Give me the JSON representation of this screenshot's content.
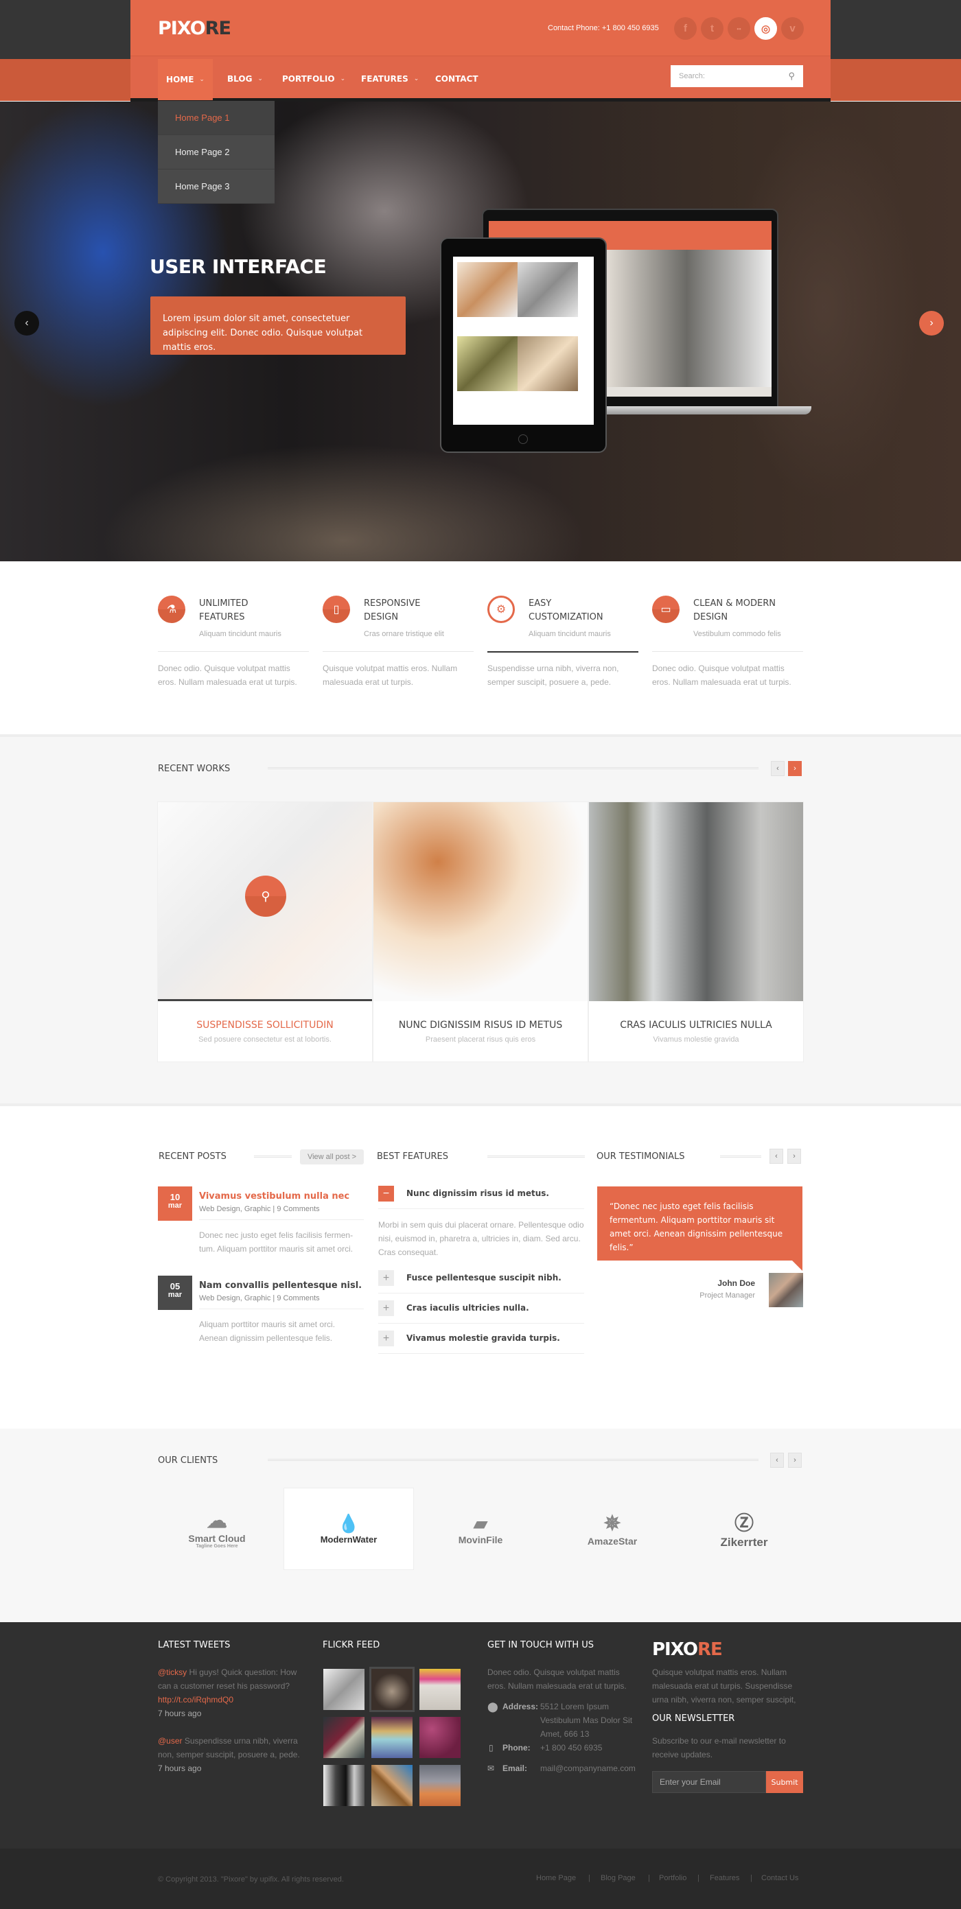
{
  "header": {
    "logo_part1": "PIXO",
    "logo_part2": "RE",
    "contact_phone": "Contact Phone: +1 800 450 6935",
    "social": [
      {
        "icon": "facebook-icon",
        "glyph": "f"
      },
      {
        "icon": "twitter-icon",
        "glyph": "t"
      },
      {
        "icon": "flickr-icon",
        "glyph": "••"
      },
      {
        "icon": "dribbble-icon",
        "glyph": "◎"
      },
      {
        "icon": "vimeo-icon",
        "glyph": "v"
      }
    ],
    "nav": [
      {
        "label": "HOME",
        "has_dropdown": true
      },
      {
        "label": "BLOG",
        "has_dropdown": true
      },
      {
        "label": "PORTFOLIO",
        "has_dropdown": true
      },
      {
        "label": "FEATURES",
        "has_dropdown": true
      },
      {
        "label": "CONTACT",
        "has_dropdown": false
      }
    ],
    "chevron": "⌄",
    "search_placeholder": "Search:",
    "search_icon": "⚲",
    "dropdown": [
      "Home Page 1",
      "Home Page 2",
      "Home Page 3"
    ]
  },
  "hero": {
    "title": "USER INTERFACE",
    "caption": "Lorem ipsum dolor sit amet, consectetuer adipiscing elit. Donec odio. Quisque volutpat mattis eros.",
    "prev_glyph": "‹",
    "next_glyph": "›"
  },
  "features": [
    {
      "icon": "flask-icon",
      "glyph": "⚗",
      "title": "UNLIMITED FEATURES",
      "subtitle": "Aliquam tincidunt mauris",
      "desc": "Donec odio. Quisque volutpat mattis eros. Nullam malesuada erat ut turpis."
    },
    {
      "icon": "mobile-icon",
      "glyph": "▯",
      "title": "RESPONSIVE DESIGN",
      "subtitle": "Cras ornare tristique elit",
      "desc": "Quisque volutpat mattis eros. Nullam malesuada erat ut turpis."
    },
    {
      "icon": "gear-icon",
      "glyph": "⚙",
      "title": "EASY CUSTOMIZATION",
      "subtitle": "Aliquam tincidunt mauris",
      "desc": "Suspendisse urna nibh, viverra non, semper suscipit, posuere a, pede."
    },
    {
      "icon": "monitor-icon",
      "glyph": "▭",
      "title": "CLEAN & MODERN DESIGN",
      "subtitle": "Vestibulum commodo felis",
      "desc": "Donec odio. Quisque volutpat mattis eros. Nullam malesuada erat ut turpis."
    }
  ],
  "recent_works": {
    "title": "RECENT WORKS",
    "prev": "‹",
    "next": "›",
    "zoom_glyph": "⚲",
    "items": [
      {
        "title": "SUSPENDISSE SOLLICITUDIN",
        "subtitle": "Sed posuere consectetur est at lobortis."
      },
      {
        "title": "NUNC DIGNISSIM RISUS ID METUS",
        "subtitle": "Praesent placerat risus quis eros"
      },
      {
        "title": "CRAS IACULIS ULTRICIES NULLA",
        "subtitle": "Vivamus molestie gravida"
      }
    ]
  },
  "recent_posts": {
    "title": "RECENT POSTS",
    "view_all": "View all post >",
    "posts": [
      {
        "day": "10",
        "month": "mar",
        "title": "Vivamus vestibulum nulla nec",
        "meta": "Web Design, Graphic | 9 Comments",
        "excerpt": "Donec nec justo eget felis facilisis fermen-tum. Aliquam porttitor mauris sit amet orci."
      },
      {
        "day": "05",
        "month": "mar",
        "title": "Nam convallis pellentesque nisl.",
        "meta": "Web Design, Graphic | 9 Comments",
        "excerpt": "Aliquam porttitor mauris sit amet orci. Aenean dignissim pellentesque felis."
      }
    ]
  },
  "best_features": {
    "title": "BEST FEATURES",
    "items": [
      {
        "title": "Nunc dignissim risus id metus.",
        "open": true,
        "body": "Morbi in sem quis dui placerat ornare. Pellentesque odio nisi, euismod in, pharetra a, ultricies in, diam. Sed arcu. Cras consequat."
      },
      {
        "title": "Fusce pellentesque suscipit nibh.",
        "open": false
      },
      {
        "title": "Cras iaculis ultricies nulla.",
        "open": false
      },
      {
        "title": "Vivamus molestie gravida turpis.",
        "open": false
      }
    ],
    "minus": "−",
    "plus": "+"
  },
  "testimonials": {
    "title": "OUR TESTIMONIALS",
    "quote": "“Donec nec justo eget felis facilisis fermentum. Aliquam porttitor mauris sit amet orci. Aenean dignissim pellentesque felis.”",
    "name": "John Doe",
    "role": "Project Manager",
    "prev": "‹",
    "next": "›"
  },
  "clients": {
    "title": "OUR CLIENTS",
    "prev": "‹",
    "next": "›",
    "logos": [
      {
        "name": "Smart Cloud",
        "tagline": "Tagline Goes Here",
        "glyph": "☁"
      },
      {
        "name": "ModernWater",
        "tagline": "",
        "glyph": "💧"
      },
      {
        "name": "MovinFile",
        "tagline": "",
        "glyph": "▰"
      },
      {
        "name": "AmazeStar",
        "tagline": "",
        "glyph": "✵"
      },
      {
        "name": "Zikerrter",
        "tagline": "",
        "glyph": "Ⓩ"
      }
    ]
  },
  "footer": {
    "tweets_title": "LATEST TWEETS",
    "tweets": [
      {
        "handle": "@ticksy",
        "text": " Hi guys! Quick question: How can a customer reset his password?",
        "link": "http://t.co/iRqhmdQ0",
        "time": "7 hours ago"
      },
      {
        "handle": "@user",
        "text": " Suspendisse urna nibh, viverra non, semper suscipit, posuere a, pede.",
        "link": "",
        "time": "7 hours ago"
      }
    ],
    "flickr_title": "FLICKR FEED",
    "contact_title": "GET IN TOUCH WITH US",
    "contact_intro": "Donec odio. Quisque volutpat mattis eros. Nullam malesuada erat ut turpis.",
    "address_label": "Address:",
    "address": "5512 Lorem Ipsum Vestibulum Mas Dolor Sit Amet, 666 13",
    "phone_label": "Phone:",
    "phone": "+1 800 450 6935",
    "email_label": "Email:",
    "email": "mail@companyname.com",
    "logo_part1": "PIXO",
    "logo_part2": "RE",
    "about": "Quisque volutpat mattis eros. Nullam malesuada erat ut turpis. Suspendisse urna nibh, viverra non, semper suscipit,",
    "newsletter_title": "OUR NEWSLETTER",
    "newsletter_text": "Subscribe to our e-mail newsletter to receive updates.",
    "newsletter_placeholder": "Enter your Email",
    "submit": "Submit",
    "copyright": "© Copyright 2013. \"Pixore\" by upifix. All rights reserved.",
    "links": [
      "Home Page",
      "Blog Page",
      "Portfolio",
      "Features",
      "Contact Us"
    ],
    "separator": "|"
  },
  "colors": {
    "accent": "#e4694a",
    "dark": "#363636",
    "footer": "#303030"
  }
}
